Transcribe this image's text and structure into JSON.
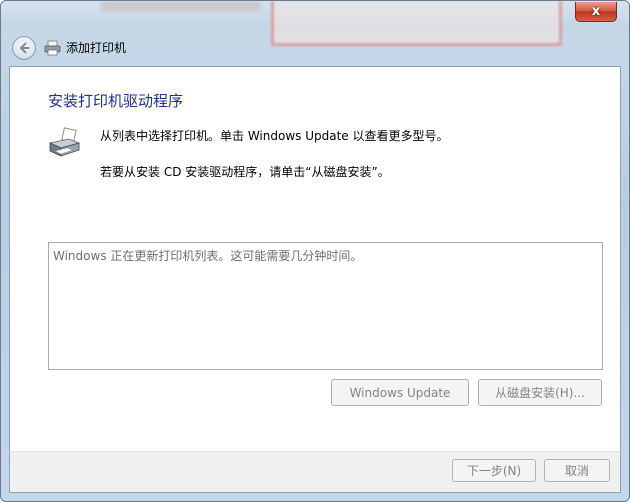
{
  "titlebar": {
    "close_label": "x"
  },
  "nav": {
    "title": "添加打印机",
    "back_icon": "back-arrow-icon",
    "printer_icon": "printer-icon"
  },
  "main": {
    "heading": "安装打印机驱动程序",
    "description_line1": "从列表中选择打印机。单击 Windows Update 以查看更多型号。",
    "description_line2": "若要从安装 CD 安装驱动程序，请单击“从磁盘安装”。",
    "list_status": "Windows 正在更新打印机列表。这可能需要几分钟时间。",
    "windows_update_button": "Windows Update",
    "from_disk_button": "从磁盘安装(H)..."
  },
  "footer": {
    "next_button": "下一步(N)",
    "cancel_button": "取消"
  },
  "colors": {
    "heading": "#1e3287",
    "disabled_text": "#838383",
    "frame": "#c2d3e5"
  }
}
